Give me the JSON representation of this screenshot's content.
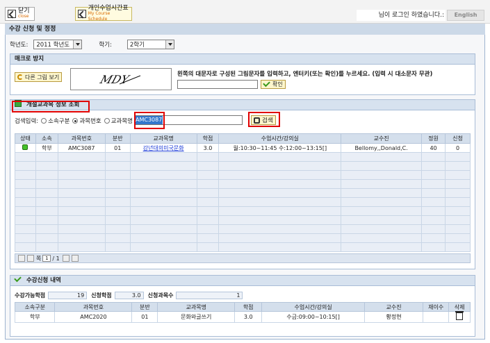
{
  "toolbar": {
    "close_label": "닫기",
    "close_sub": "close",
    "schedule_label": "개인수업시간표",
    "schedule_sub": "My Course Schedule",
    "login_text": "님이 로그인 하였습니다.:",
    "lang_label": "English"
  },
  "page": {
    "title": "수강 신청 및 정정"
  },
  "filters": {
    "year_label": "학년도:",
    "year_value": "2011 학년도",
    "term_label": "학기:",
    "term_value": "2학기"
  },
  "macro": {
    "title": "매크로 방지",
    "refresh_label": "다른 그림 보기",
    "captcha_text": "MDY",
    "instruction": "왼쪽의 대문자로 구성된 그림문자를 입력하고, 엔터키(또는 확인)를 누르세요. (입력 시 대소문자 무관)",
    "confirm_label": "확인"
  },
  "search": {
    "title": "개설교과목 정보 조회",
    "input_label": "검색입력:",
    "radio_options": [
      "소속구분",
      "과목번호",
      "교과목명"
    ],
    "selected_radio": "과목번호",
    "query": "AMC3087",
    "search_label": "검색",
    "columns": [
      "상태",
      "소속",
      "과목번호",
      "분반",
      "교과목명",
      "학점",
      "수업시간/강의실",
      "교수진",
      "정원",
      "신청"
    ],
    "rows": [
      {
        "status": "green",
        "dept": "학부",
        "code": "AMC3087",
        "section": "01",
        "name": "강년대의미국문화",
        "credit": "3.0",
        "time": "월:10:30~11:45 수:12:00~13:15[]",
        "prof": "Bellomy,,Donald,C.",
        "capacity": "40",
        "applied": "0"
      }
    ],
    "pager": {
      "page_label": "쪽",
      "current": "1",
      "total": "/ 1"
    }
  },
  "registered": {
    "title": "수강신청 내역",
    "max_credit_label": "수강가능학점",
    "max_credit_value": "19",
    "applied_credit_label": "신청학점",
    "applied_credit_value": "3.0",
    "course_count_label": "신청과목수",
    "course_count_value": "1",
    "columns": [
      "소속구분",
      "과목번호",
      "분반",
      "교과목명",
      "학점",
      "수업시간/강의실",
      "교수진",
      "재이수",
      "삭제"
    ],
    "rows": [
      {
        "dept": "학부",
        "code": "AMC2020",
        "section": "01",
        "name": "문화와글쓰기",
        "credit": "3.0",
        "time": "수금:09:00~10:15[]",
        "prof": "황정현",
        "retake": ""
      }
    ]
  },
  "colors": {
    "highlight": "#e00000",
    "panel_header": "#d7e2ef",
    "status_green": "#44c12a"
  },
  "icons": [
    "close-icon",
    "schedule-icon",
    "refresh-icon",
    "check-icon",
    "search-panel-icon",
    "binoculars-icon",
    "trash-icon"
  ]
}
